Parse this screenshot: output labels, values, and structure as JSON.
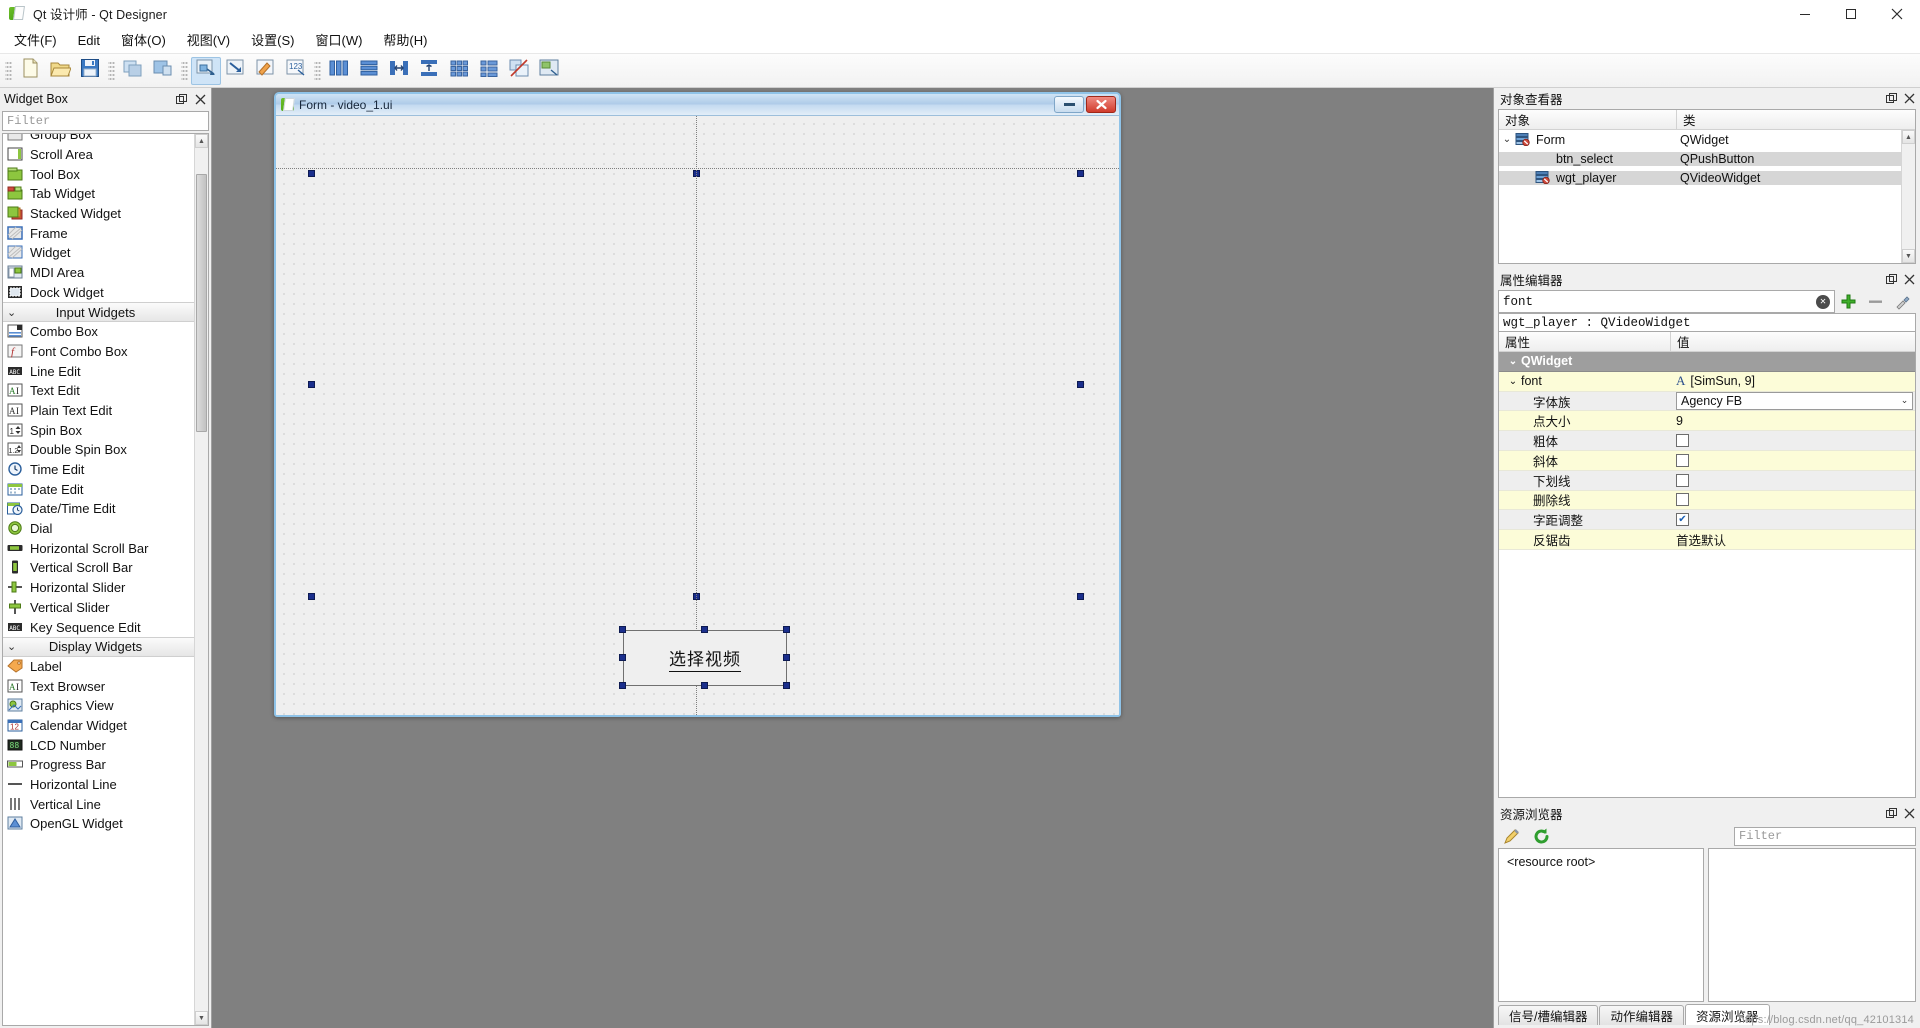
{
  "window": {
    "title": "Qt 设计师 - Qt Designer",
    "app_icon": "qt-designer-icon",
    "minimize": "minimize-icon",
    "maximize": "maximize-icon",
    "close": "close-icon"
  },
  "menubar": {
    "items": [
      {
        "label": "文件(F)",
        "name": "menu-file"
      },
      {
        "label": "Edit",
        "name": "menu-edit"
      },
      {
        "label": "窗体(O)",
        "name": "menu-form"
      },
      {
        "label": "视图(V)",
        "name": "menu-view"
      },
      {
        "label": "设置(S)",
        "name": "menu-settings"
      },
      {
        "label": "窗口(W)",
        "name": "menu-window"
      },
      {
        "label": "帮助(H)",
        "name": "menu-help"
      }
    ]
  },
  "toolbar": {
    "groups": [
      {
        "buttons": [
          {
            "name": "new-form-button",
            "icon": "new-file-icon",
            "active": false
          },
          {
            "name": "open-form-button",
            "icon": "open-folder-icon",
            "active": false
          },
          {
            "name": "save-form-button",
            "icon": "save-disk-icon",
            "active": false
          }
        ]
      },
      {
        "buttons": [
          {
            "name": "undo-button",
            "icon": "undo-icon",
            "active": false
          },
          {
            "name": "redo-button",
            "icon": "redo-icon",
            "active": false
          }
        ]
      },
      {
        "buttons": [
          {
            "name": "edit-widgets-button",
            "icon": "edit-widgets-icon",
            "active": true
          },
          {
            "name": "edit-signals-slots-button",
            "icon": "signals-slots-icon",
            "active": false
          },
          {
            "name": "edit-buddies-button",
            "icon": "buddies-icon",
            "active": false
          },
          {
            "name": "edit-tab-order-button",
            "icon": "tab-order-icon",
            "active": false
          }
        ]
      },
      {
        "buttons": [
          {
            "name": "layout-horizontally-button",
            "icon": "layout-horizontal-icon",
            "active": false
          },
          {
            "name": "layout-vertically-button",
            "icon": "layout-vertical-icon",
            "active": false
          },
          {
            "name": "layout-splitter-horizontal-button",
            "icon": "splitter-horizontal-icon",
            "active": false
          },
          {
            "name": "layout-splitter-vertical-button",
            "icon": "splitter-vertical-icon",
            "active": false
          },
          {
            "name": "layout-grid-button",
            "icon": "layout-grid-icon",
            "active": false
          },
          {
            "name": "layout-form-button",
            "icon": "layout-form-icon",
            "active": false
          },
          {
            "name": "break-layout-button",
            "icon": "break-layout-icon",
            "active": false
          },
          {
            "name": "adjust-size-button",
            "icon": "adjust-size-icon",
            "active": false
          }
        ]
      }
    ]
  },
  "widget_box": {
    "title": "Widget Box",
    "float_icon": "float-panel-icon",
    "close_icon": "close-panel-icon",
    "filter_placeholder": "Filter",
    "rows": [
      {
        "type": "item",
        "label": "Group Box",
        "icon": "group-box-icon",
        "clipped": true
      },
      {
        "type": "item",
        "label": "Scroll Area",
        "icon": "scroll-area-icon"
      },
      {
        "type": "item",
        "label": "Tool Box",
        "icon": "tool-box-icon"
      },
      {
        "type": "item",
        "label": "Tab Widget",
        "icon": "tab-widget-icon"
      },
      {
        "type": "item",
        "label": "Stacked Widget",
        "icon": "stacked-widget-icon"
      },
      {
        "type": "item",
        "label": "Frame",
        "icon": "frame-icon"
      },
      {
        "type": "item",
        "label": "Widget",
        "icon": "widget-icon"
      },
      {
        "type": "item",
        "label": "MDI Area",
        "icon": "mdi-area-icon"
      },
      {
        "type": "item",
        "label": "Dock Widget",
        "icon": "dock-widget-icon"
      },
      {
        "type": "category",
        "label": "Input Widgets",
        "icon": "chevron-down-icon"
      },
      {
        "type": "item",
        "label": "Combo Box",
        "icon": "combo-box-icon"
      },
      {
        "type": "item",
        "label": "Font Combo Box",
        "icon": "font-combo-box-icon"
      },
      {
        "type": "item",
        "label": "Line Edit",
        "icon": "line-edit-icon"
      },
      {
        "type": "item",
        "label": "Text Edit",
        "icon": "text-edit-icon"
      },
      {
        "type": "item",
        "label": "Plain Text Edit",
        "icon": "plain-text-edit-icon"
      },
      {
        "type": "item",
        "label": "Spin Box",
        "icon": "spin-box-icon"
      },
      {
        "type": "item",
        "label": "Double Spin Box",
        "icon": "double-spin-box-icon"
      },
      {
        "type": "item",
        "label": "Time Edit",
        "icon": "time-edit-icon"
      },
      {
        "type": "item",
        "label": "Date Edit",
        "icon": "date-edit-icon"
      },
      {
        "type": "item",
        "label": "Date/Time Edit",
        "icon": "date-time-edit-icon"
      },
      {
        "type": "item",
        "label": "Dial",
        "icon": "dial-icon"
      },
      {
        "type": "item",
        "label": "Horizontal Scroll Bar",
        "icon": "horizontal-scroll-bar-icon"
      },
      {
        "type": "item",
        "label": "Vertical Scroll Bar",
        "icon": "vertical-scroll-bar-icon"
      },
      {
        "type": "item",
        "label": "Horizontal Slider",
        "icon": "horizontal-slider-icon"
      },
      {
        "type": "item",
        "label": "Vertical Slider",
        "icon": "vertical-slider-icon"
      },
      {
        "type": "item",
        "label": "Key Sequence Edit",
        "icon": "key-sequence-edit-icon"
      },
      {
        "type": "category",
        "label": "Display Widgets",
        "icon": "chevron-down-icon"
      },
      {
        "type": "item",
        "label": "Label",
        "icon": "label-icon"
      },
      {
        "type": "item",
        "label": "Text Browser",
        "icon": "text-browser-icon"
      },
      {
        "type": "item",
        "label": "Graphics View",
        "icon": "graphics-view-icon"
      },
      {
        "type": "item",
        "label": "Calendar Widget",
        "icon": "calendar-widget-icon"
      },
      {
        "type": "item",
        "label": "LCD Number",
        "icon": "lcd-number-icon"
      },
      {
        "type": "item",
        "label": "Progress Bar",
        "icon": "progress-bar-icon"
      },
      {
        "type": "item",
        "label": "Horizontal Line",
        "icon": "horizontal-line-icon"
      },
      {
        "type": "item",
        "label": "Vertical Line",
        "icon": "vertical-line-icon"
      },
      {
        "type": "item",
        "label": "OpenGL Widget",
        "icon": "opengl-widget-icon"
      }
    ]
  },
  "form_window": {
    "title": "Form - video_1.ui",
    "icon": "qt-form-icon",
    "minimize": "minimize-icon",
    "close": "close-icon",
    "selected_button": {
      "name": "btn-select-video",
      "label": "选择视频"
    }
  },
  "object_inspector": {
    "title": "对象查看器",
    "float_icon": "float-panel-icon",
    "close_icon": "close-panel-icon",
    "columns": [
      "对象",
      "类"
    ],
    "rows": [
      {
        "name": "Form",
        "class": "QWidget",
        "level": 0,
        "expanded": true,
        "icon": "widget-node-icon",
        "selected": false
      },
      {
        "name": "btn_select",
        "class": "QPushButton",
        "level": 1,
        "expanded": false,
        "icon": "push-button-node-icon",
        "selected": true
      },
      {
        "name": "wgt_player",
        "class": "QVideoWidget",
        "level": 1,
        "expanded": false,
        "icon": "video-widget-node-icon",
        "selected": true
      }
    ]
  },
  "property_editor": {
    "title": "属性编辑器",
    "float_icon": "float-panel-icon",
    "close_icon": "close-panel-icon",
    "search_value": "font",
    "clear_icon": "clear-search-icon",
    "add_icon": "add-property-icon",
    "remove_icon": "remove-property-icon",
    "configure_icon": "configure-property-icon",
    "object_line": "wgt_player : QVideoWidget",
    "columns": [
      "属性",
      "值"
    ],
    "rows": [
      {
        "kind": "group",
        "key": "QWidget",
        "value": "",
        "expanded": true
      },
      {
        "kind": "sub1",
        "key": "font",
        "value": "[SimSun, 9]",
        "expanded": true,
        "value_icon": "font-A-icon"
      },
      {
        "kind": "sub2",
        "key": "字体族",
        "value": "Agency FB",
        "editor": "combo"
      },
      {
        "kind": "sub2",
        "key": "点大小",
        "value": "9",
        "editor": "text"
      },
      {
        "kind": "sub2",
        "key": "粗体",
        "value": "",
        "editor": "checkbox",
        "checked": false
      },
      {
        "kind": "sub2",
        "key": "斜体",
        "value": "",
        "editor": "checkbox",
        "checked": false
      },
      {
        "kind": "sub2",
        "key": "下划线",
        "value": "",
        "editor": "checkbox",
        "checked": false
      },
      {
        "kind": "sub2",
        "key": "删除线",
        "value": "",
        "editor": "checkbox",
        "checked": false
      },
      {
        "kind": "sub2",
        "key": "字距调整",
        "value": "",
        "editor": "checkbox",
        "checked": true
      },
      {
        "kind": "sub2",
        "key": "反锯齿",
        "value": "首选默认",
        "editor": "text"
      }
    ]
  },
  "resource_browser": {
    "title": "资源浏览器",
    "float_icon": "float-panel-icon",
    "close_icon": "close-panel-icon",
    "edit_icon": "edit-pencil-icon",
    "reload_icon": "reload-green-icon",
    "filter_placeholder": "Filter",
    "root_label": "<resource root>"
  },
  "bottom_tabs": {
    "tabs": [
      {
        "label": "信号/槽编辑器",
        "name": "tab-signal-slot-editor",
        "active": false
      },
      {
        "label": "动作编辑器",
        "name": "tab-action-editor",
        "active": false
      },
      {
        "label": "资源浏览器",
        "name": "tab-resource-browser",
        "active": true
      }
    ]
  },
  "watermark": "https://blog.csdn.net/qq_42101314"
}
